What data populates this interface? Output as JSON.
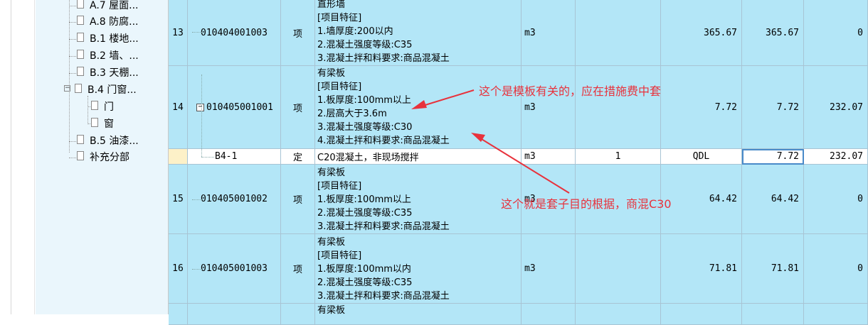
{
  "tree": {
    "items": [
      {
        "label": "A.7 屋面..."
      },
      {
        "label": "A.8 防腐..."
      },
      {
        "label": "B.1 楼地..."
      },
      {
        "label": "B.2 墙、..."
      },
      {
        "label": "B.3 天棚..."
      },
      {
        "label": "B.4 门窗..."
      },
      {
        "label": "门"
      },
      {
        "label": "窗"
      },
      {
        "label": "B.5 油漆..."
      },
      {
        "label": "补充分部"
      }
    ],
    "expander_symbol": "−"
  },
  "rows": [
    {
      "index": "13",
      "code": "010404001003",
      "unit_type": "项",
      "desc": [
        "直形墙",
        "[项目特征]",
        "1.墙厚度:200以内",
        "2.混凝土强度等级:C35",
        "3.混凝土拌和料要求:商品混凝土"
      ],
      "unit": "m3",
      "factor": "",
      "qty_expr": "365.67",
      "qty": "365.67",
      "price": "0"
    },
    {
      "index": "14",
      "code": "010405001001",
      "unit_type": "项",
      "expander": "−",
      "desc": [
        "有梁板",
        "[项目特征]",
        "1.板厚度:100mm以上",
        "2.层高大于3.6m",
        "3.混凝土强度等级:C30",
        "4.混凝土拌和料要求:商品混凝土"
      ],
      "unit": "m3",
      "factor": "",
      "qty_expr": "7.72",
      "qty": "7.72",
      "price": "232.07"
    },
    {
      "index": "",
      "code": "B4-1",
      "unit_type": "定",
      "desc": [
        "C20混凝土，非现场搅拌"
      ],
      "unit": "m3",
      "factor": "1",
      "qty_expr": "QDL",
      "qty": "7.72",
      "price": "232.07"
    },
    {
      "index": "15",
      "code": "010405001002",
      "unit_type": "项",
      "desc": [
        "有梁板",
        "[项目特征]",
        "1.板厚度:100mm以上",
        "2.混凝土强度等级:C35",
        "3.混凝土拌和料要求:商品混凝土"
      ],
      "unit": "m3",
      "factor": "",
      "qty_expr": "64.42",
      "qty": "64.42",
      "price": "0"
    },
    {
      "index": "16",
      "code": "010405001003",
      "unit_type": "项",
      "desc": [
        "有梁板",
        "[项目特征]",
        "1.板厚度:100mm以内",
        "2.混凝土强度等级:C35",
        "3.混凝土拌和料要求:商品混凝土"
      ],
      "unit": "m3",
      "factor": "",
      "qty_expr": "71.81",
      "qty": "71.81",
      "price": "0"
    },
    {
      "index": "",
      "code": "",
      "unit_type": "",
      "desc": [
        "有梁板"
      ],
      "unit": "",
      "factor": "",
      "qty_expr": "",
      "qty": "",
      "price": ""
    }
  ],
  "annotations": {
    "note1": "这个是模板有关的，应在措施费中套",
    "note2": "这个就是套子目的根据，商混C30"
  },
  "colors": {
    "row_blue": "#b3e6f7",
    "tree_bg": "#eaf6fc",
    "annotation_red": "#e8323c",
    "selected_border": "#4a8ac9"
  }
}
